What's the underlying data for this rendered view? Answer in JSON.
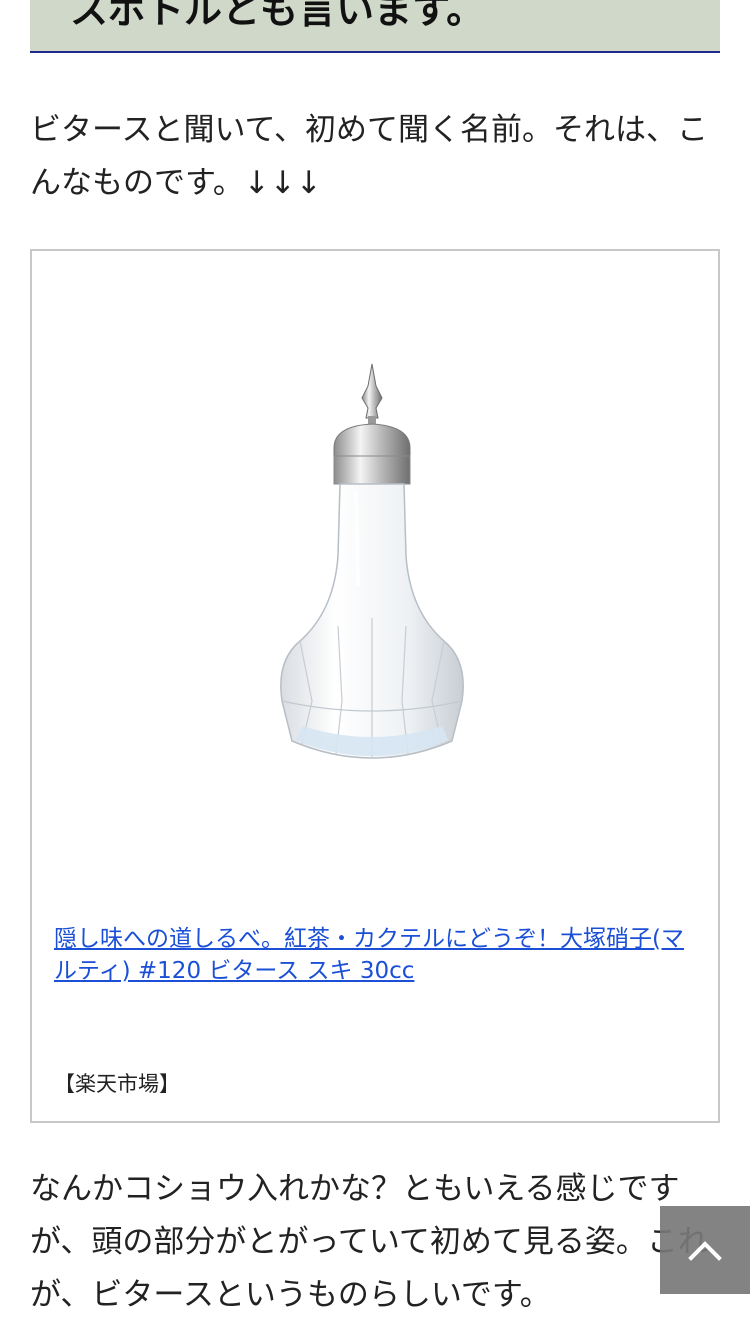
{
  "section_heading": "スボトルとも言います。",
  "paragraphs": {
    "intro": "ビタースと聞いて、初めて聞く名前。それは、こんなものです。↓↓↓",
    "after": "なんかコショウ入れかな？ともいえる感じですが、頭の部分がとがっていて初めて見る姿。これが、ビタースというものらしいです。"
  },
  "product": {
    "image_icon": "bitters-bottle-image",
    "link_text": "隠し味への道しるべ。紅茶・カクテルにどうぞ！大塚硝子(マルティ) #120 ビタース スキ 30cc",
    "source": "【楽天市場】"
  },
  "scroll_top": {
    "icon": "chevron-up-icon"
  },
  "colors": {
    "heading_bg": "#cfd8c9",
    "heading_border": "#1e2a8a",
    "link": "#1a4fd6",
    "card_border": "#c8c8c8",
    "scroll_button_bg": "#787878"
  }
}
